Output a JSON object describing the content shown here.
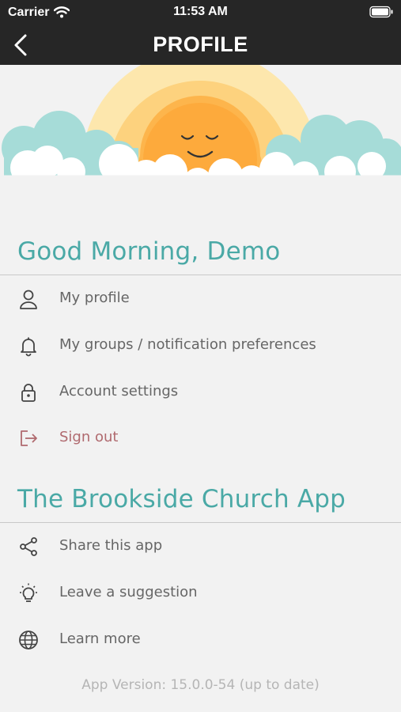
{
  "status_bar": {
    "carrier": "Carrier",
    "time": "11:53 AM"
  },
  "header": {
    "title": "PROFILE"
  },
  "greeting_section": {
    "title": "Good Morning, Demo",
    "items": [
      {
        "label": "My profile",
        "icon": "person-icon"
      },
      {
        "label": "My groups / notification preferences",
        "icon": "bell-icon"
      },
      {
        "label": "Account settings",
        "icon": "lock-icon"
      },
      {
        "label": "Sign out",
        "icon": "sign-out-icon"
      }
    ]
  },
  "app_section": {
    "title": "The Brookside Church App",
    "items": [
      {
        "label": "Share this app",
        "icon": "share-icon"
      },
      {
        "label": "Leave a suggestion",
        "icon": "lightbulb-icon"
      },
      {
        "label": "Learn more",
        "icon": "globe-icon"
      }
    ]
  },
  "version": "App Version: 15.0.0-54 (up to date)",
  "colors": {
    "accent": "#4aa9a6",
    "signout": "#b06a6f",
    "bar": "#262626"
  }
}
